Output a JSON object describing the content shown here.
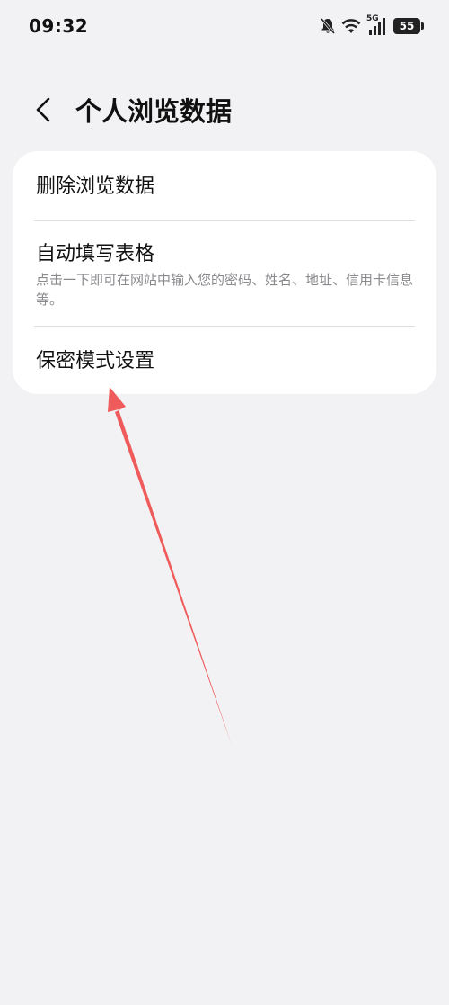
{
  "status_bar": {
    "time": "09:32",
    "network": "5G",
    "battery_level": "55"
  },
  "header": {
    "title": "个人浏览数据",
    "back_icon": "chevron-left-icon"
  },
  "settings": {
    "items": [
      {
        "title": "删除浏览数据"
      },
      {
        "title": "自动填写表格",
        "subtitle": "点击一下即可在网站中输入您的密码、姓名、地址、信用卡信息等。"
      },
      {
        "title": "保密模式设置"
      }
    ]
  },
  "colors": {
    "background": "#f2f1f3",
    "card": "#ffffff",
    "annotation_arrow": "#ef5b5b"
  }
}
